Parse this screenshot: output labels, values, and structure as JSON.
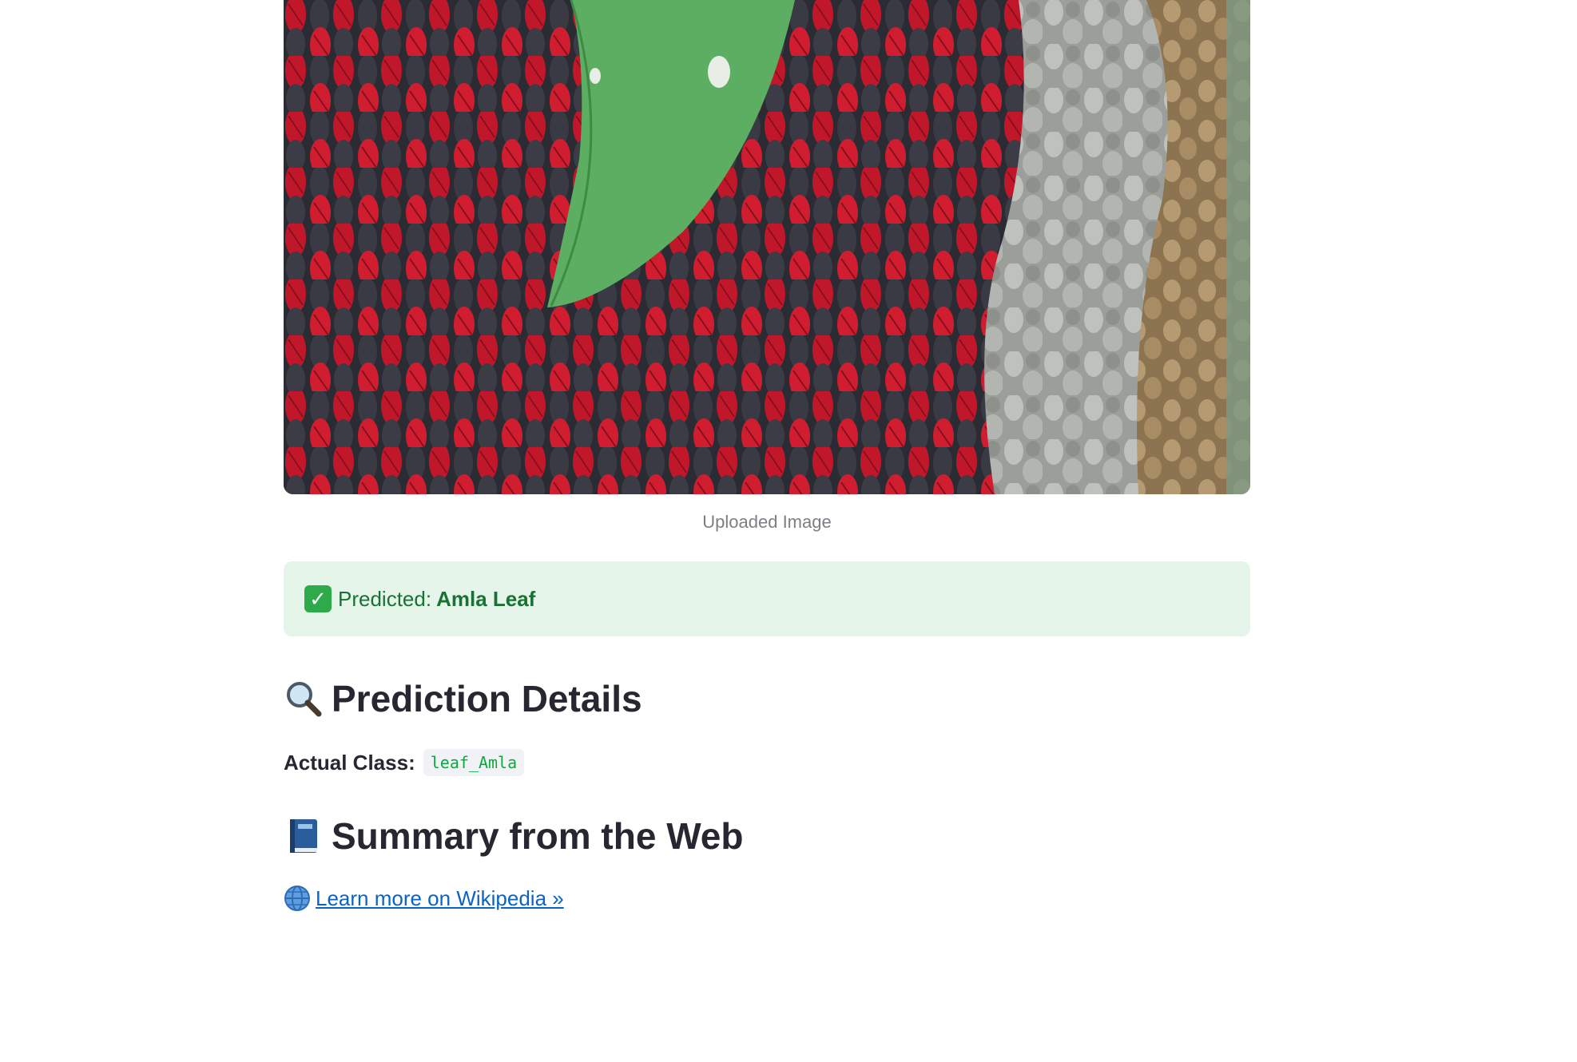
{
  "image": {
    "caption": "Uploaded Image",
    "alt": "Uploaded leaf photo on woven fabric rug"
  },
  "prediction": {
    "label": "Predicted:",
    "value": "Amla Leaf",
    "icon": "check-mark-icon"
  },
  "details": {
    "heading": "Prediction Details",
    "icon": "magnifier-icon",
    "actual_label": "Actual Class:",
    "actual_value": "leaf_Amla"
  },
  "summary": {
    "heading": "Summary from the Web",
    "icon": "book-icon",
    "link_text": "Learn more on Wikipedia »",
    "link_icon": "globe-icon"
  },
  "colors": {
    "success_bg": "#e6f5ea",
    "success_text": "#177233",
    "code_text": "#09ab3b",
    "link": "#0b63c4"
  }
}
